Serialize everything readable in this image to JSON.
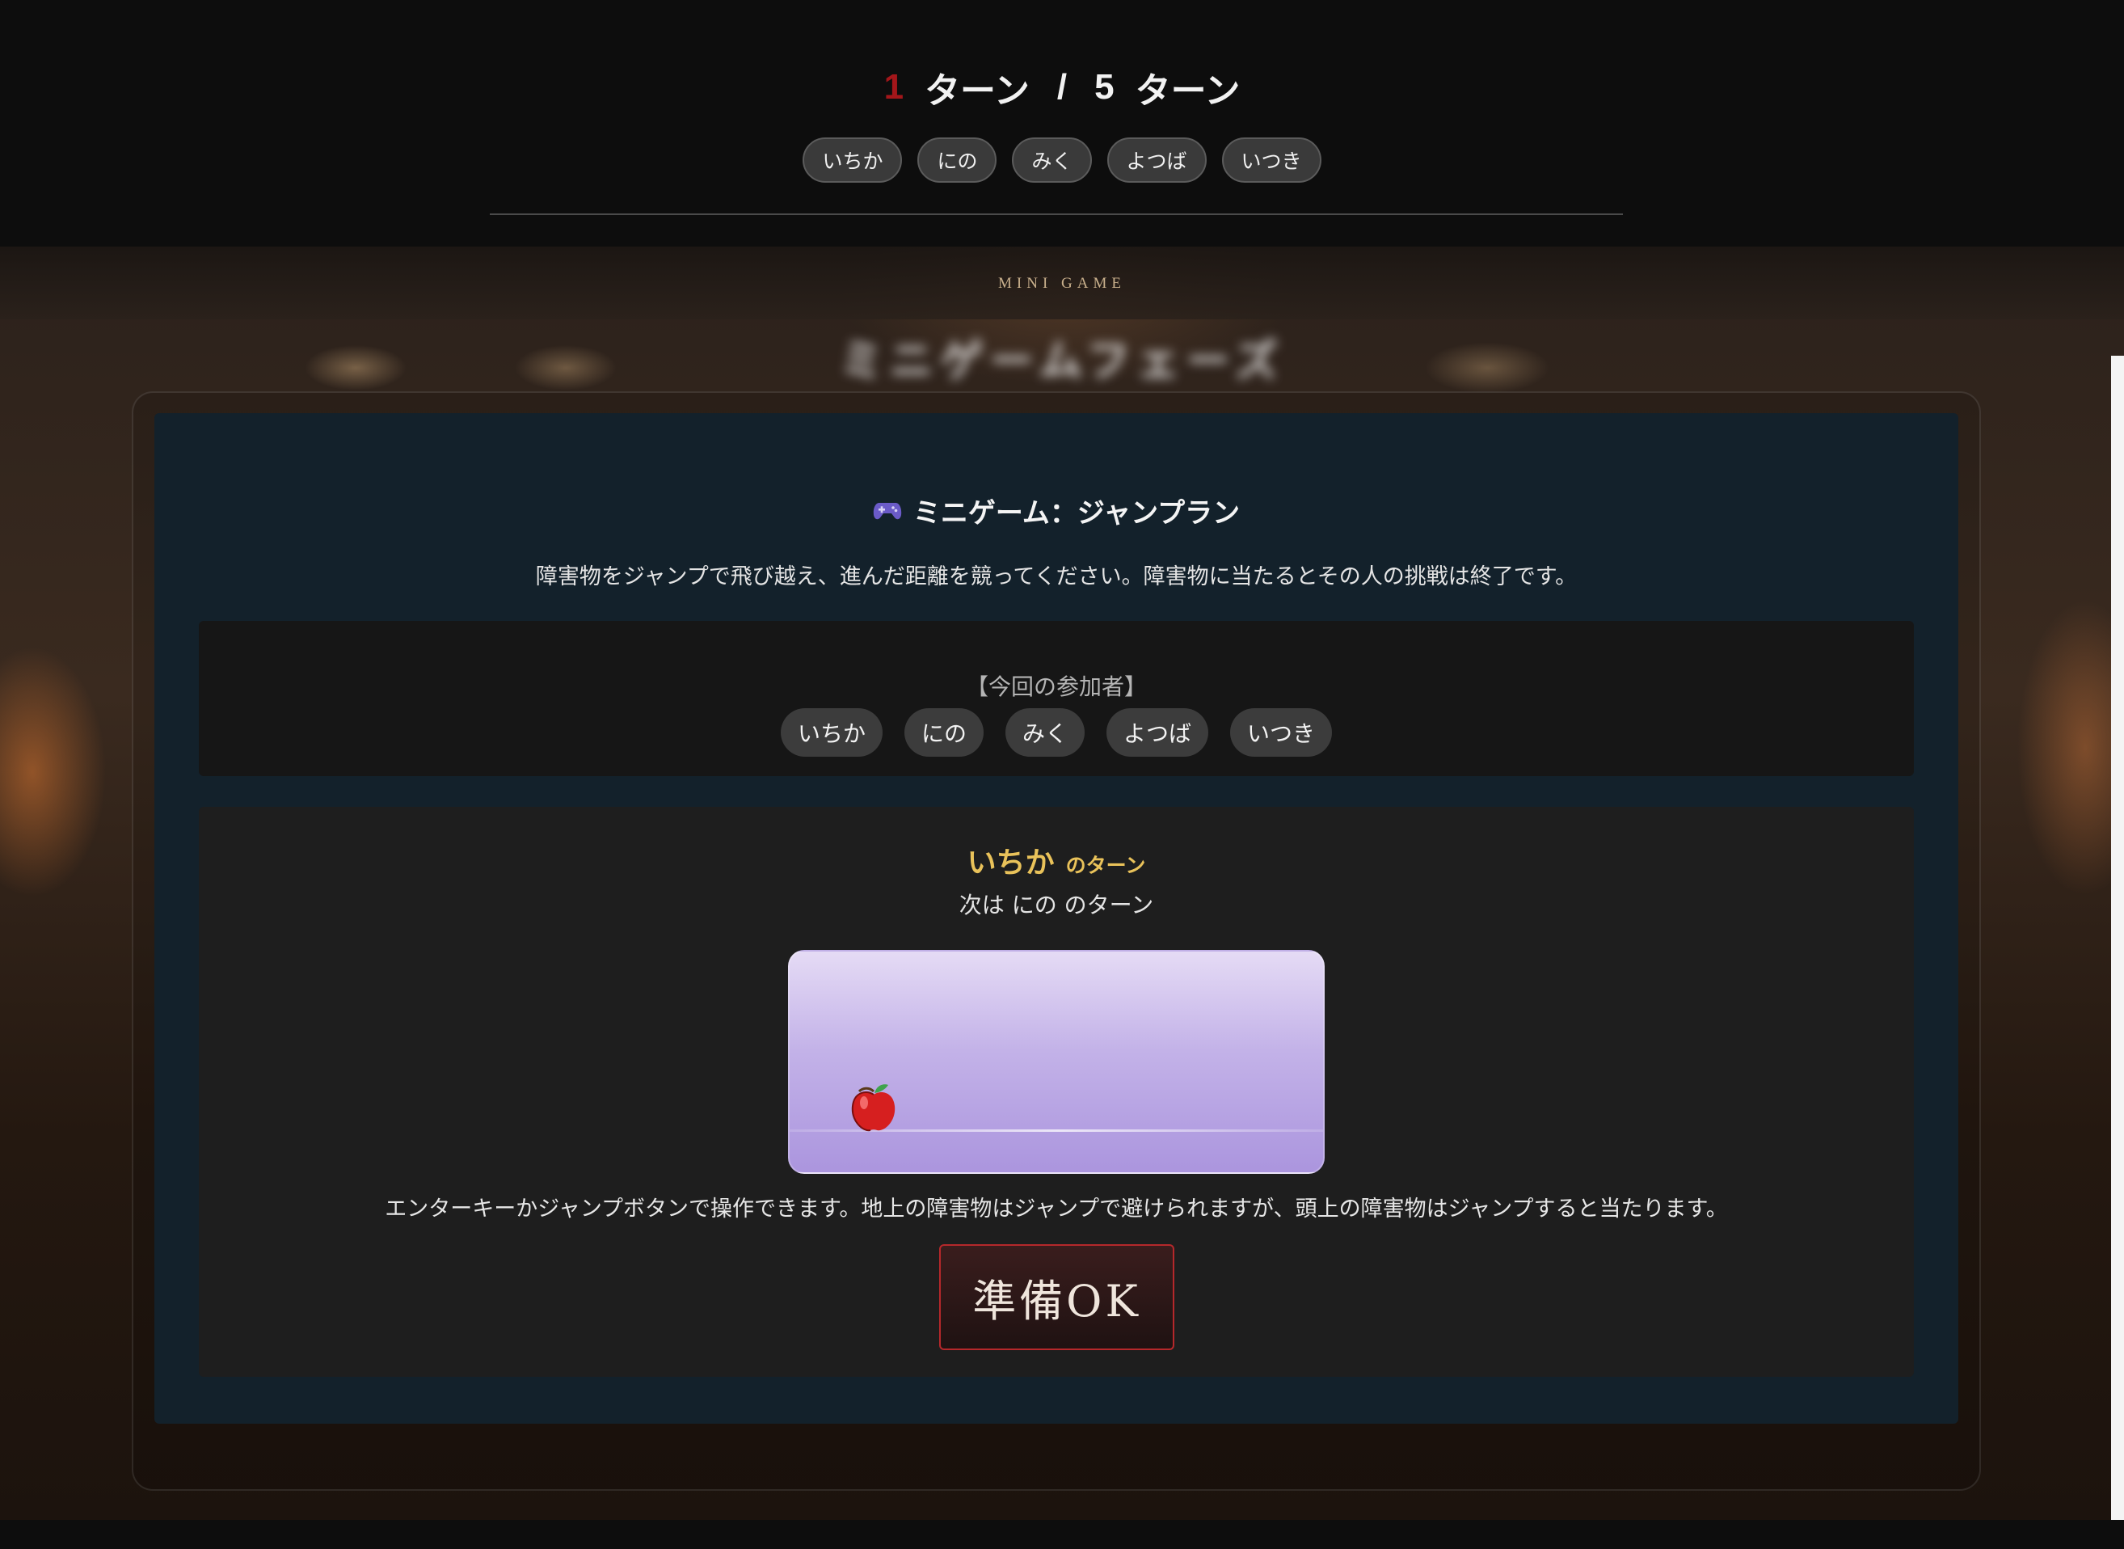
{
  "header": {
    "turn_current": "1",
    "turn_unit": "ターン",
    "separator": "/",
    "turn_total": "5",
    "turn_total_unit": "ターン",
    "players": [
      "いちか",
      "にの",
      "みく",
      "よつば",
      "いつき"
    ]
  },
  "section": {
    "tag": "MINI GAME",
    "blurred_title": "ミニゲームフェーズ"
  },
  "game": {
    "icon": "gamepad-icon",
    "title": "ミニゲーム：ジャンプラン",
    "description": "障害物をジャンプで飛び越え、進んだ距離を競ってください。障害物に当たるとその人の挑戦は終了です。"
  },
  "participants": {
    "label": "【今回の参加者】",
    "names": [
      "いちか",
      "にの",
      "みく",
      "よつば",
      "いつき"
    ]
  },
  "turn": {
    "current_name": "いちか",
    "current_suffix": "のターン",
    "next_text": "次は にの のターン"
  },
  "canvas": {
    "character": "apple-icon"
  },
  "instructions": "エンターキーかジャンプボタンで操作できます。地上の障害物はジャンプで避けられますが、頭上の障害物はジャンプすると当たります。",
  "ready_button": "準備OK",
  "colors": {
    "accent_red": "#a3161a",
    "turn_gold": "#e9c25a",
    "card_bg": "#13212b"
  }
}
